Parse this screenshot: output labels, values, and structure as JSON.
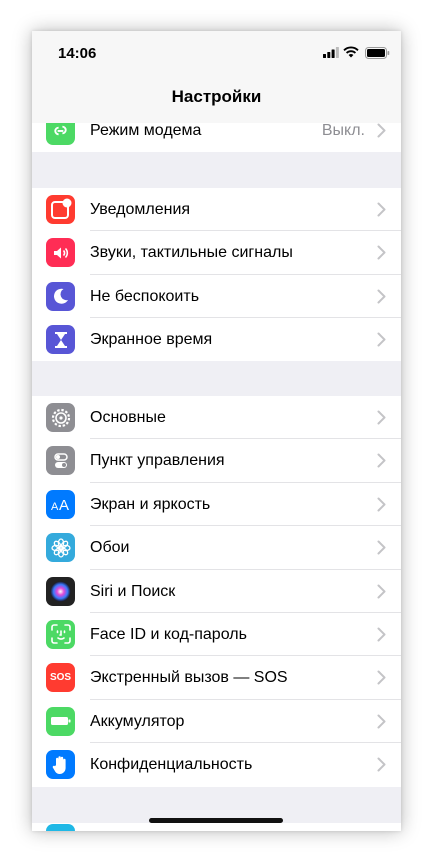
{
  "status_bar": {
    "time": "14:06"
  },
  "nav": {
    "title": "Настройки"
  },
  "sections": [
    {
      "rows": [
        {
          "key": "hotspot",
          "label": "Режим модема",
          "value": "Выкл.",
          "icon": "hotspot-icon",
          "color": "#4cd964"
        }
      ]
    },
    {
      "rows": [
        {
          "key": "notifications",
          "label": "Уведомления",
          "icon": "notifications-icon",
          "color": "#ff3b30"
        },
        {
          "key": "sounds",
          "label": "Звуки, тактильные сигналы",
          "icon": "speaker-icon",
          "color": "#ff2d55"
        },
        {
          "key": "dnd",
          "label": "Не беспокоить",
          "icon": "moon-icon",
          "color": "#5856d6"
        },
        {
          "key": "screen-time",
          "label": "Экранное время",
          "icon": "hourglass-icon",
          "color": "#5856d6"
        }
      ]
    },
    {
      "rows": [
        {
          "key": "general",
          "label": "Основные",
          "icon": "gear-icon",
          "color": "#8e8e93"
        },
        {
          "key": "control-center",
          "label": "Пункт управления",
          "icon": "toggles-icon",
          "color": "#8e8e93"
        },
        {
          "key": "display",
          "label": "Экран и яркость",
          "icon": "text-size-icon",
          "color": "#007aff"
        },
        {
          "key": "wallpaper",
          "label": "Обои",
          "icon": "flower-icon",
          "color": "#34aadc"
        },
        {
          "key": "siri",
          "label": "Siri и Поиск",
          "icon": "siri-icon",
          "color": "#222222"
        },
        {
          "key": "face-id",
          "label": "Face ID и код-пароль",
          "icon": "face-id-icon",
          "color": "#4cd964"
        },
        {
          "key": "sos",
          "label": "Экстренный вызов — SOS",
          "icon": "sos-icon",
          "color": "#ff3b30",
          "badge": "SOS"
        },
        {
          "key": "battery",
          "label": "Аккумулятор",
          "icon": "battery-icon",
          "color": "#4cd964"
        },
        {
          "key": "privacy",
          "label": "Конфиденциальность",
          "icon": "hand-icon",
          "color": "#007aff"
        }
      ]
    }
  ]
}
